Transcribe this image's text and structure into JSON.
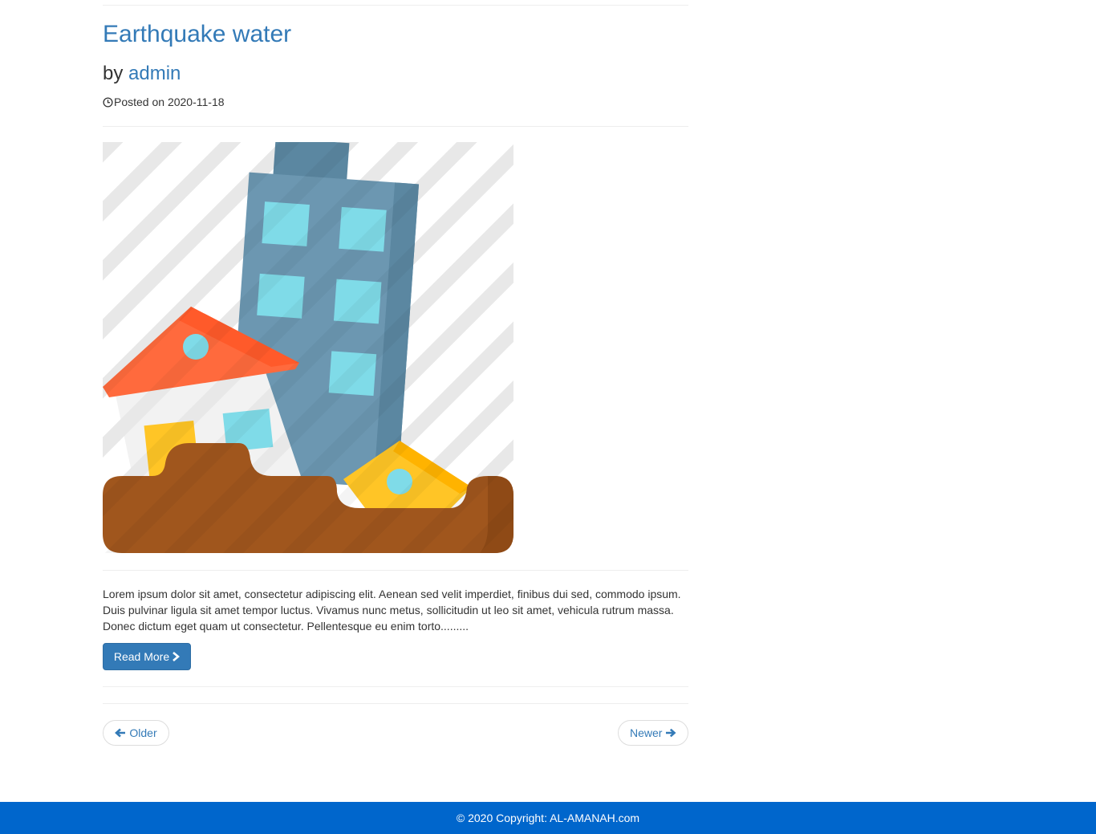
{
  "post": {
    "title": "Earthquake water",
    "by_prefix": "by",
    "author": "admin",
    "posted_on": "Posted on 2020-11-18",
    "image_subject": "earthquake illustration: tilted building, house and hut sinking into ground",
    "excerpt": "Lorem ipsum dolor sit amet, consectetur adipiscing elit. Aenean sed velit imperdiet, finibus dui sed, commodo ipsum. Duis pulvinar ligula sit amet tempor luctus. Vivamus nunc metus, sollicitudin ut leo sit amet, vehicula rutrum massa. Donec dictum eget quam ut consectetur. Pellentesque eu enim torto.........",
    "read_more_label": "Read More"
  },
  "pager": {
    "older_label": "Older",
    "newer_label": "Newer"
  },
  "footer": {
    "copyright": "© 2020 Copyright: AL-AMANAH.com"
  },
  "icons": {
    "clock": "clock-icon",
    "read_more": "chevron-right-icon",
    "older": "arrow-left-icon",
    "newer": "arrow-right-icon"
  },
  "colors": {
    "link": "#337ab7",
    "primary_button": "#337ab7",
    "footer": "#0066cc",
    "building": "#6c97b1",
    "window": "#7fdbe8",
    "roof": "#ff6a3d",
    "ground": "#a0561d",
    "hut": "#ffc526"
  }
}
